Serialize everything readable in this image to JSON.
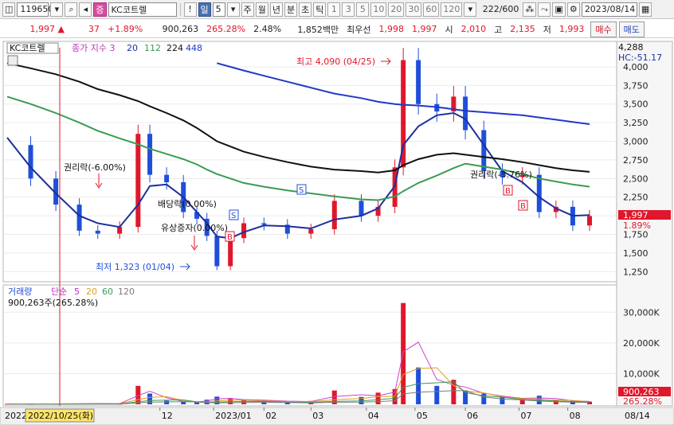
{
  "toolbar": {
    "code": "119650",
    "badge": "증",
    "name": "KC코트렐",
    "excl": "!",
    "il_label": "일",
    "il_value": "5",
    "periods": [
      "주",
      "월",
      "년",
      "분",
      "초",
      "틱"
    ],
    "intervals": [
      "1",
      "3",
      "5",
      "10",
      "20",
      "30",
      "60",
      "120"
    ],
    "count": "222",
    "count_total": "/600",
    "date": "2023/08/14"
  },
  "quote": {
    "price": "1,997",
    "arrow": "▲",
    "change": "37",
    "change_pct": "+1.89%",
    "volume": "900,263",
    "vol_ratio": "265.28%",
    "turnover": "2.48%",
    "amount": "1,852백만",
    "best_label": "최우선",
    "best_ask": "1,998",
    "best_bid": "1,997",
    "open_label": "시",
    "open": "2,010",
    "high_label": "고",
    "high": "2,135",
    "low_label": "저",
    "low": "1,993",
    "buy": "매수",
    "sell": "매도"
  },
  "legend": {
    "name": "KC코트렐",
    "ma_title": "종가 지수 3",
    "ma1": "20",
    "ma2": "112",
    "ma3": "224",
    "ma4": "448",
    "hc": "HC:-51.17",
    "top_price": "4,288"
  },
  "annotations": {
    "high": "최고 4,090 (04/25)",
    "low": "최저 1,323 (01/04)",
    "ex_rights": "권리락(-6.00%)",
    "ex_div": "배당락(0.00%)",
    "rights_offer": "유상증자(0.00%)",
    "other": "권리락(-3.76%)",
    "s": "S",
    "b": "B"
  },
  "price_tags": {
    "last": "1,997",
    "pct": "1.89%"
  },
  "volume_legend": {
    "title": "거래량",
    "ma_title": "단순",
    "m1": "5",
    "m2": "20",
    "m3": "60",
    "m4": "120",
    "value_line": "900,263주(265.28%)",
    "last_tag": "900,263",
    "pct_tag": "265.28%"
  },
  "x_axis": {
    "year_label": "2022",
    "selected_date": "2022/10/25(화)",
    "ticks": [
      "12",
      "2023/01",
      "02",
      "03",
      "04",
      "05",
      "06",
      "07",
      "08"
    ],
    "right_label": "08/14"
  },
  "colors": {
    "up": "#e0172b",
    "down": "#1f4fd9",
    "ma_navy": "#1c2f9e",
    "ma_black": "#111111",
    "ma_green": "#3c9a55",
    "ma_blue": "#2438c9",
    "vma5": "#cc44cc",
    "vma20": "#e0a020",
    "vma60": "#3c9a55",
    "vma120": "#7a7a7a"
  },
  "chart_data": [
    {
      "type": "line",
      "title": "KC코트렐",
      "xlabel": "",
      "ylabel": "",
      "x": [
        "2022-09-01",
        "2022-09-15",
        "2022-09-30",
        "2022-10-14",
        "2022-10-25",
        "2022-11-07",
        "2022-11-18",
        "2022-11-25",
        "2022-12-05",
        "2022-12-15",
        "2022-12-23",
        "2022-12-29",
        "2023-01-04",
        "2023-01-12",
        "2023-01-20",
        "2023-02-01",
        "2023-02-15",
        "2023-03-01",
        "2023-03-15",
        "2023-03-31",
        "2023-04-10",
        "2023-04-20",
        "2023-04-25",
        "2023-05-04",
        "2023-05-15",
        "2023-05-25",
        "2023-06-01",
        "2023-06-12",
        "2023-06-23",
        "2023-07-05",
        "2023-07-15",
        "2023-07-25",
        "2023-08-04",
        "2023-08-14"
      ],
      "series": [
        {
          "name": "종가",
          "values": [
            2950,
            2500,
            2150,
            1800,
            1760,
            1850,
            3100,
            2550,
            2450,
            2050,
            1960,
            1730,
            1323,
            1700,
            1900,
            1880,
            1760,
            1820,
            2200,
            2000,
            2120,
            2650,
            4090,
            3500,
            3400,
            3600,
            3150,
            2600,
            2520,
            2550,
            2050,
            2120,
            1870,
            1997
          ]
        },
        {
          "name": "20",
          "values": [
            3050,
            2650,
            2300,
            2000,
            1900,
            1850,
            2150,
            2400,
            2420,
            2250,
            2050,
            1900,
            1720,
            1700,
            1780,
            1870,
            1860,
            1830,
            1950,
            2000,
            2100,
            2400,
            2950,
            3200,
            3350,
            3380,
            3300,
            2950,
            2600,
            2450,
            2250,
            2100,
            2000,
            2010
          ]
        },
        {
          "name": "112",
          "values": [
            4050,
            3980,
            3900,
            3800,
            3700,
            3620,
            3540,
            3470,
            3380,
            3280,
            3180,
            3090,
            3000,
            2930,
            2860,
            2790,
            2720,
            2660,
            2620,
            2600,
            2580,
            2610,
            2680,
            2760,
            2820,
            2840,
            2820,
            2790,
            2760,
            2720,
            2680,
            2640,
            2610,
            2590
          ]
        },
        {
          "name": "224",
          "values": [
            3600,
            3500,
            3380,
            3250,
            3140,
            3040,
            2960,
            2900,
            2830,
            2760,
            2690,
            2620,
            2560,
            2500,
            2440,
            2390,
            2340,
            2300,
            2260,
            2220,
            2210,
            2260,
            2330,
            2440,
            2540,
            2640,
            2700,
            2660,
            2620,
            2560,
            2500,
            2460,
            2420,
            2390
          ]
        },
        {
          "name": "448",
          "values": [
            null,
            null,
            null,
            null,
            null,
            null,
            null,
            null,
            null,
            null,
            null,
            null,
            4050,
            4000,
            3950,
            3880,
            3800,
            3720,
            3640,
            3580,
            3530,
            3500,
            3490,
            3480,
            3460,
            3430,
            3410,
            3390,
            3370,
            3350,
            3320,
            3290,
            3260,
            3230
          ]
        }
      ],
      "ylim": [
        1125,
        4288
      ]
    },
    {
      "type": "bar",
      "title": "거래량",
      "xlabel": "",
      "ylabel": "",
      "x": [
        "2022-09-01",
        "2022-09-15",
        "2022-09-30",
        "2022-10-14",
        "2022-10-25",
        "2022-11-07",
        "2022-11-18",
        "2022-11-25",
        "2022-12-05",
        "2022-12-15",
        "2022-12-23",
        "2022-12-29",
        "2023-01-04",
        "2023-01-12",
        "2023-01-20",
        "2023-02-01",
        "2023-02-15",
        "2023-03-01",
        "2023-03-15",
        "2023-03-31",
        "2023-04-10",
        "2023-04-20",
        "2023-04-25",
        "2023-05-04",
        "2023-05-15",
        "2023-05-25",
        "2023-06-01",
        "2023-06-12",
        "2023-06-23",
        "2023-07-05",
        "2023-07-15",
        "2023-07-25",
        "2023-08-04",
        "2023-08-14"
      ],
      "series": [
        {
          "name": "거래량",
          "values": [
            150000,
            120000,
            180000,
            250000,
            300000,
            200000,
            6000000,
            3500000,
            1200000,
            800000,
            900000,
            1500000,
            2500000,
            1800000,
            1600000,
            1400000,
            900000,
            1100000,
            4500000,
            2400000,
            3800000,
            5000000,
            33000000,
            12000000,
            6000000,
            8000000,
            4500000,
            3500000,
            2500000,
            1800000,
            2800000,
            1400000,
            1200000,
            900263
          ]
        }
      ],
      "ylim": [
        0,
        35000000
      ]
    }
  ]
}
